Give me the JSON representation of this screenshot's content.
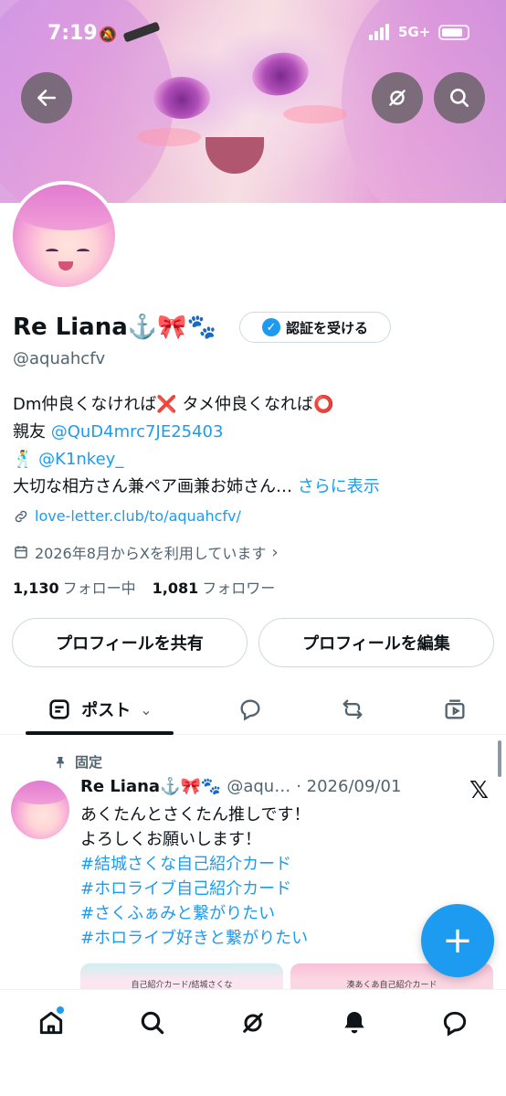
{
  "status_bar": {
    "time": "7:19",
    "network": "5G+"
  },
  "profile": {
    "name": "Re Liana⚓️🎀🐾",
    "verify_label": "認証を受ける",
    "handle": "@aquahcfv",
    "bio": {
      "line1": "Dm仲良くなければ❌ タメ仲良くなれば⭕️",
      "line2_prefix": "親友 ",
      "line2_link": "@QuD4mrc7JE25403",
      "line3_prefix": "🕺 ",
      "line3_link": "@K1nkey_",
      "line4_text": "大切な相方さん兼ペア画兼お姉さん…",
      "line4_more": " さらに表示"
    },
    "website": "love-letter.club/to/aquahcfv/",
    "joined": "2026年8月からXを利用しています",
    "following_count": "1,130",
    "following_label": "フォロー中",
    "followers_count": "1,081",
    "followers_label": "フォロワー",
    "share_button": "プロフィールを共有",
    "edit_button": "プロフィールを編集"
  },
  "tabs": {
    "active_label": "ポスト"
  },
  "tweet": {
    "pinned_label": "固定",
    "name": "Re Liana⚓️🎀🐾",
    "handle": "@aqu…",
    "date": "· 2026/09/01",
    "lines": [
      "あくたんとさくたん推しです！",
      "よろしくお願いします！"
    ],
    "hashtags": [
      "#結城さくな自己紹介カード",
      "#ホロライブ自己紹介カード",
      "#さくふぁみと繋がりたい",
      "#ホロライブ好きと繋がりたい"
    ],
    "card_a_label": "自己紹介カード/結城さくな",
    "card_b_label": "湊あくあ自己紹介カード"
  },
  "colors": {
    "accent": "#1d9bf0",
    "text": "#0f1419",
    "secondary": "#536471"
  },
  "icons": {
    "back": "arrow-left-icon",
    "grok": "grok-icon",
    "search": "search-icon"
  }
}
